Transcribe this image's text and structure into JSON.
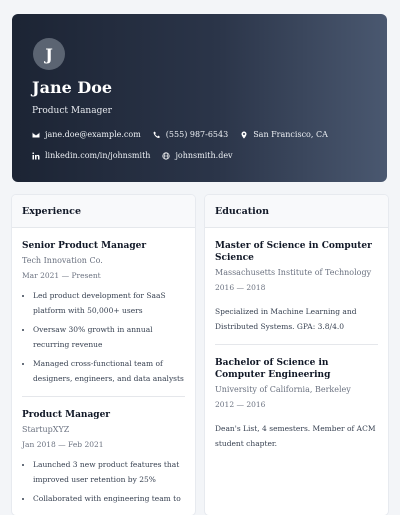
{
  "header": {
    "avatar_initial": "J",
    "name": "Jane Doe",
    "title": "Product Manager",
    "email": "jane.doe@example.com",
    "phone": "(555) 987-6543",
    "location": "San Francisco, CA",
    "linkedin": "linkedin.com/in/johnsmith",
    "website": "johnsmith.dev",
    "colors": {
      "gradient_start": "#1c2434",
      "gradient_end": "#4a5870"
    }
  },
  "icons": {
    "email": "envelope-icon",
    "phone": "phone-icon",
    "location": "map-pin-icon",
    "linkedin": "linkedin-icon",
    "website": "globe-icon"
  },
  "experience": {
    "heading": "Experience",
    "items": [
      {
        "role": "Senior Product Manager",
        "company": "Tech Innovation Co.",
        "dates": "Mar 2021 — Present",
        "bullets": [
          "Led product development for SaaS platform with 50,000+ users",
          "Oversaw 30% growth in annual recurring revenue",
          "Managed cross-functional team of designers, engineers, and data analysts"
        ]
      },
      {
        "role": "Product Manager",
        "company": "StartupXYZ",
        "dates": "Jan 2018 — Feb 2021",
        "bullets": [
          "Launched 3 new product features that improved user retention by 25%",
          "Collaborated with engineering team to"
        ]
      }
    ]
  },
  "education": {
    "heading": "Education",
    "items": [
      {
        "degree": "Master of Science in Computer Science",
        "school": "Massachusetts Institute of Technology",
        "dates": "2016 — 2018",
        "details": "Specialized in Machine Learning and Distributed Systems. GPA: 3.8/4.0"
      },
      {
        "degree": "Bachelor of Science in Computer Engineering",
        "school": "University of California, Berkeley",
        "dates": "2012 — 2016",
        "details": "Dean's List, 4 semesters. Member of ACM student chapter."
      }
    ]
  }
}
